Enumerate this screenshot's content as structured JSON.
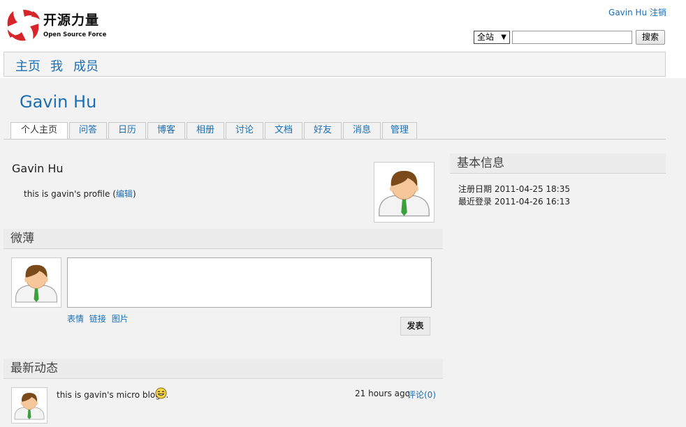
{
  "header": {
    "logo": {
      "text_cn": "开源力量",
      "text_en": "Open Source Force"
    },
    "user_name": "Gavin Hu",
    "logout_label": "注销",
    "search": {
      "scope_value": "全站",
      "query": "",
      "button_label": "搜索"
    }
  },
  "main_nav": {
    "items": [
      {
        "label": "主页"
      },
      {
        "label": "我"
      },
      {
        "label": "成员"
      }
    ]
  },
  "profile": {
    "title": "Gavin Hu",
    "tabs": [
      {
        "label": "个人主页"
      },
      {
        "label": "问答"
      },
      {
        "label": "日历"
      },
      {
        "label": "博客"
      },
      {
        "label": "相册"
      },
      {
        "label": "讨论"
      },
      {
        "label": "文档"
      },
      {
        "label": "好友"
      },
      {
        "label": "消息"
      },
      {
        "label": "管理"
      }
    ],
    "name": "Gavin Hu",
    "bio": "this is gavin's profile",
    "edit_label": "编辑"
  },
  "weibo": {
    "title": "微薄",
    "textarea_value": "",
    "tools": [
      {
        "label": "表情"
      },
      {
        "label": "链接"
      },
      {
        "label": "图片"
      }
    ],
    "publish_label": "发表"
  },
  "activity": {
    "title": "最新动态",
    "items": [
      {
        "text": "this is gavin's micro blog...",
        "time": "21 hours ago",
        "comment_label": "评论(0)"
      }
    ]
  },
  "basic_info": {
    "title": "基本信息",
    "rows": [
      {
        "label": "注册日期",
        "value": "2011-04-25 18:35"
      },
      {
        "label": "最近登录",
        "value": "2011-04-26 16:13"
      }
    ]
  },
  "colors": {
    "link": "#1a6eb5",
    "logo_red": "#d7262b",
    "avatar_shirt_tie": "#3aa03a"
  }
}
